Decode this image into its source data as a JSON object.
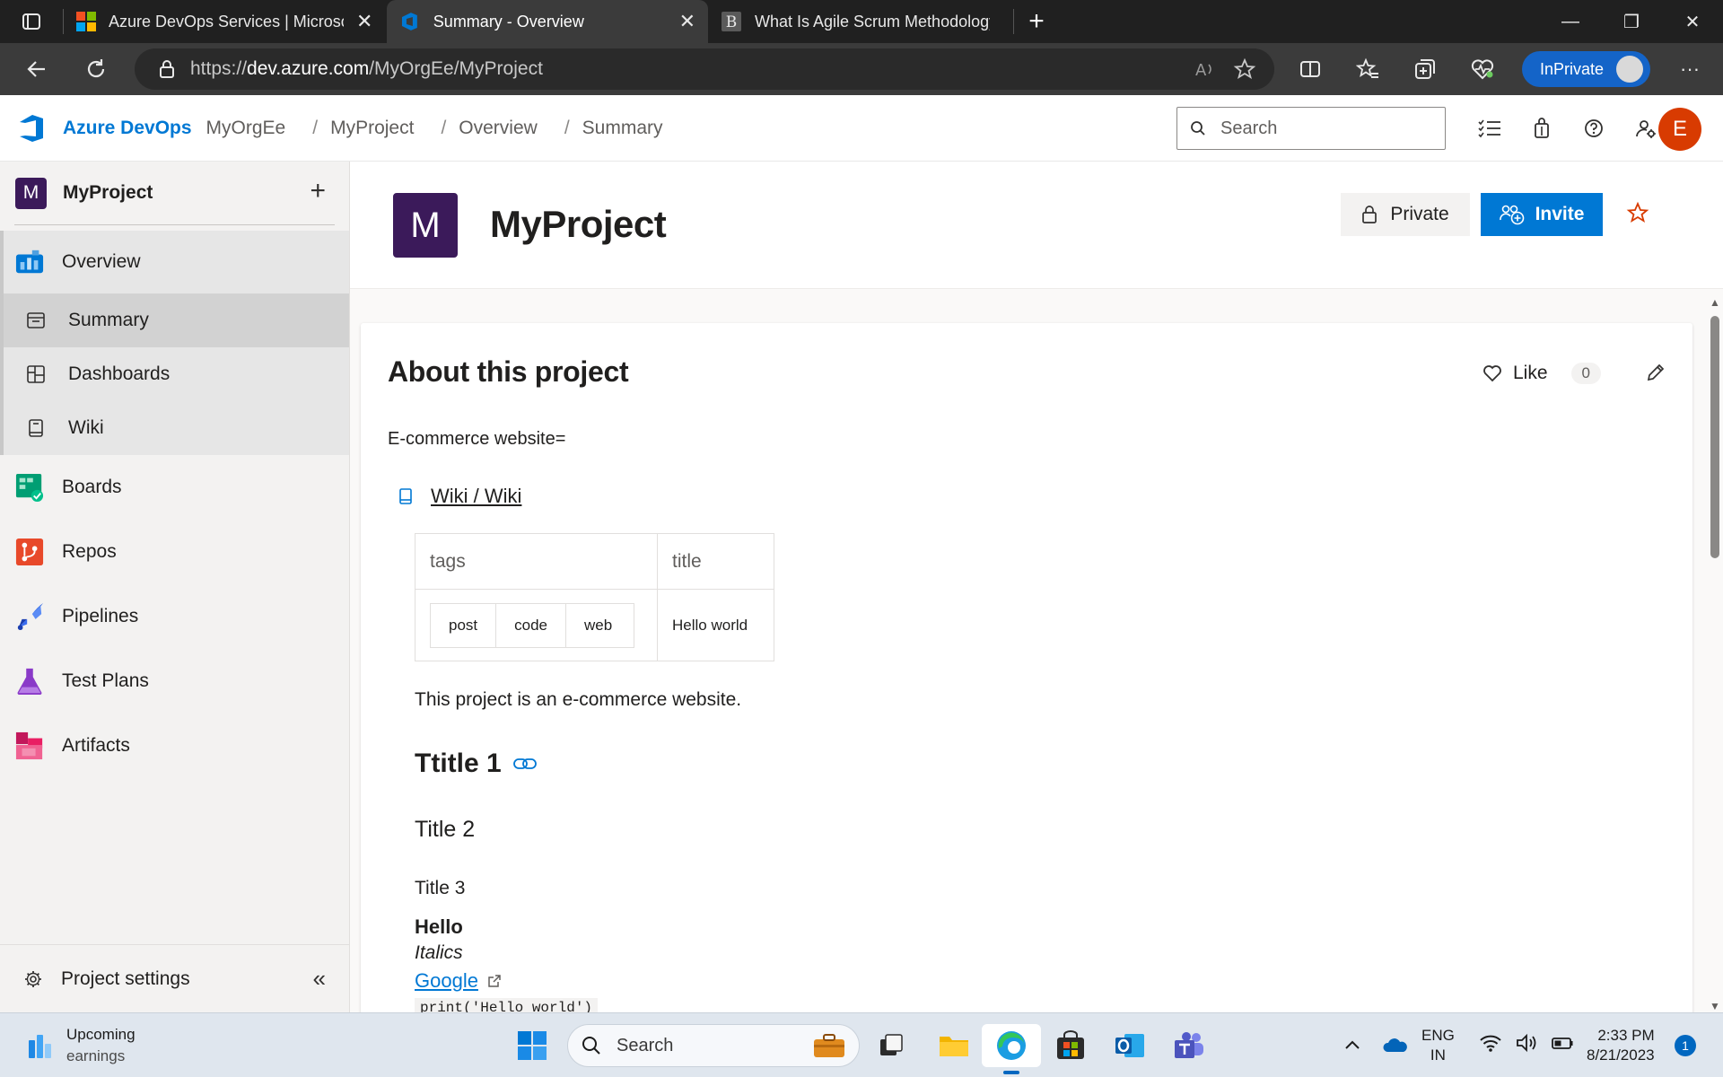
{
  "browser": {
    "tabs": [
      {
        "title": "Azure DevOps Services | Microsoft Azure",
        "icon": "microsoft-logo-icon",
        "active": false
      },
      {
        "title": "Summary - Overview",
        "icon": "azure-devops-icon",
        "active": true
      },
      {
        "title": "What Is Agile Scrum Methodology",
        "icon": "b-site-icon",
        "active": false
      }
    ],
    "url_prefix": "https://",
    "url_host": "dev.azure.com",
    "url_path": "/MyOrgEe/MyProject",
    "inprivate_label": "InPrivate"
  },
  "header": {
    "brand": "Azure DevOps",
    "breadcrumbs": [
      "MyOrgEe",
      "MyProject",
      "Overview",
      "Summary"
    ],
    "search_placeholder": "Search",
    "user_initial": "E"
  },
  "sidebar": {
    "project_initial": "M",
    "project_name": "MyProject",
    "items": [
      {
        "label": "Overview",
        "icon": "overview-icon"
      },
      {
        "label": "Summary",
        "icon": "summary-icon",
        "selected": true
      },
      {
        "label": "Dashboards",
        "icon": "dashboards-icon"
      },
      {
        "label": "Wiki",
        "icon": "wiki-icon"
      },
      {
        "label": "Boards",
        "icon": "boards-icon"
      },
      {
        "label": "Repos",
        "icon": "repos-icon"
      },
      {
        "label": "Pipelines",
        "icon": "pipelines-icon"
      },
      {
        "label": "Test Plans",
        "icon": "test-plans-icon"
      },
      {
        "label": "Artifacts",
        "icon": "artifacts-icon"
      }
    ],
    "settings_label": "Project settings"
  },
  "project": {
    "initial": "M",
    "name": "MyProject",
    "private_label": "Private",
    "invite_label": "Invite"
  },
  "about": {
    "title": "About this project",
    "like_label": "Like",
    "like_count": "0",
    "description": "E-commerce website=",
    "wiki_link": "Wiki / Wiki",
    "table": {
      "headers": [
        "tags",
        "title"
      ],
      "tags": [
        "post",
        "code",
        "web"
      ],
      "title_value": "Hello world"
    },
    "body_text": "This project is an e-commerce website.",
    "heading1": "Ttitle 1",
    "heading2": "Title 2",
    "heading3": "Title 3",
    "bold_text": "Hello",
    "italic_text": "Italics",
    "link_text": "Google",
    "code_text": "print('Hello world')"
  },
  "taskbar": {
    "weather_title": "Upcoming",
    "weather_sub": "earnings",
    "search_placeholder": "Search",
    "lang_line1": "ENG",
    "lang_line2": "IN",
    "time": "2:33 PM",
    "date": "8/21/2023",
    "notification_count": "1"
  }
}
